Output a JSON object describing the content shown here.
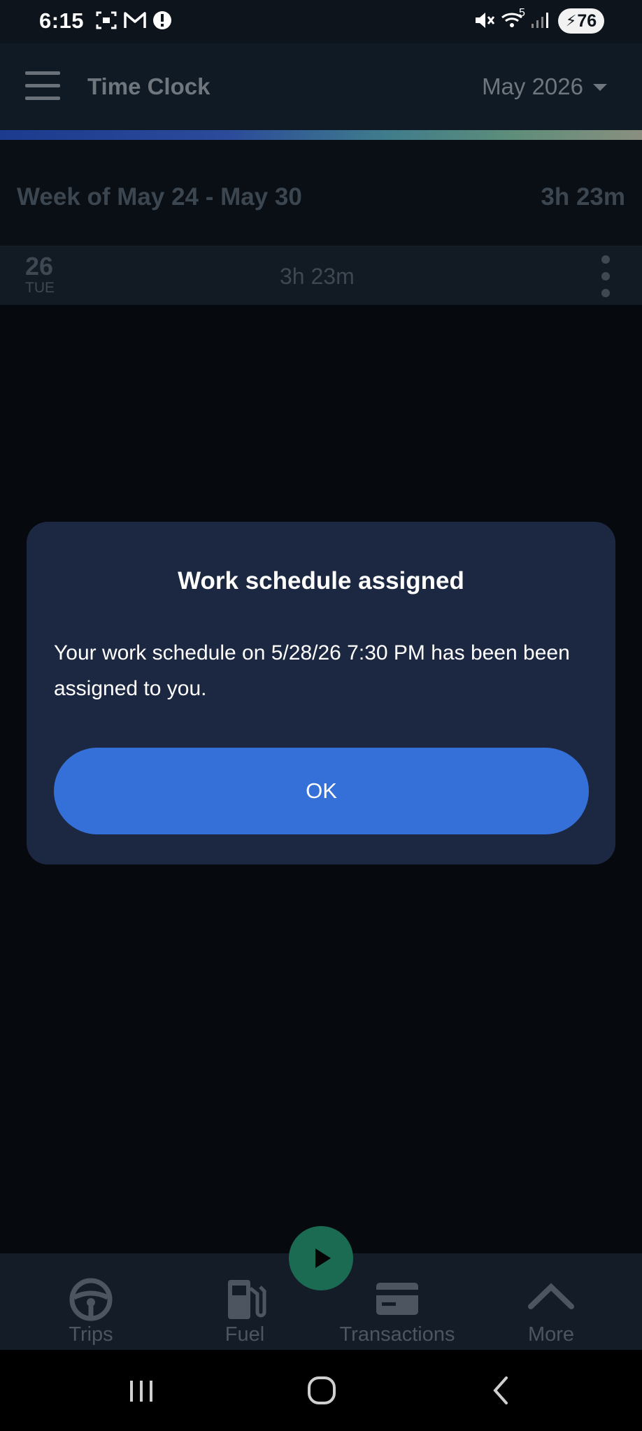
{
  "status_bar": {
    "time": "6:15",
    "signal_label": "5",
    "battery": "76"
  },
  "app_bar": {
    "title": "Time Clock",
    "month": "May 2026"
  },
  "week": {
    "label": "Week of May 24 - May 30",
    "total": "3h 23m"
  },
  "day": {
    "number": "26",
    "weekday": "TUE",
    "hours": "3h 23m"
  },
  "dialog": {
    "title": "Work schedule assigned",
    "message": "Your work schedule on 5/28/26 7:30 PM has been been assigned to you.",
    "ok_label": "OK"
  },
  "bottom_nav": {
    "items": [
      {
        "label": "Trips",
        "icon": "steering-wheel-icon"
      },
      {
        "label": "Fuel",
        "icon": "fuel-pump-icon"
      },
      {
        "label": "Transactions",
        "icon": "credit-card-icon"
      },
      {
        "label": "More",
        "icon": "chevron-up-icon"
      }
    ],
    "fab_icon": "play-icon"
  },
  "colors": {
    "accent_button": "#356fd8",
    "dialog_bg": "#1c2841",
    "fab": "#1b6a52"
  }
}
